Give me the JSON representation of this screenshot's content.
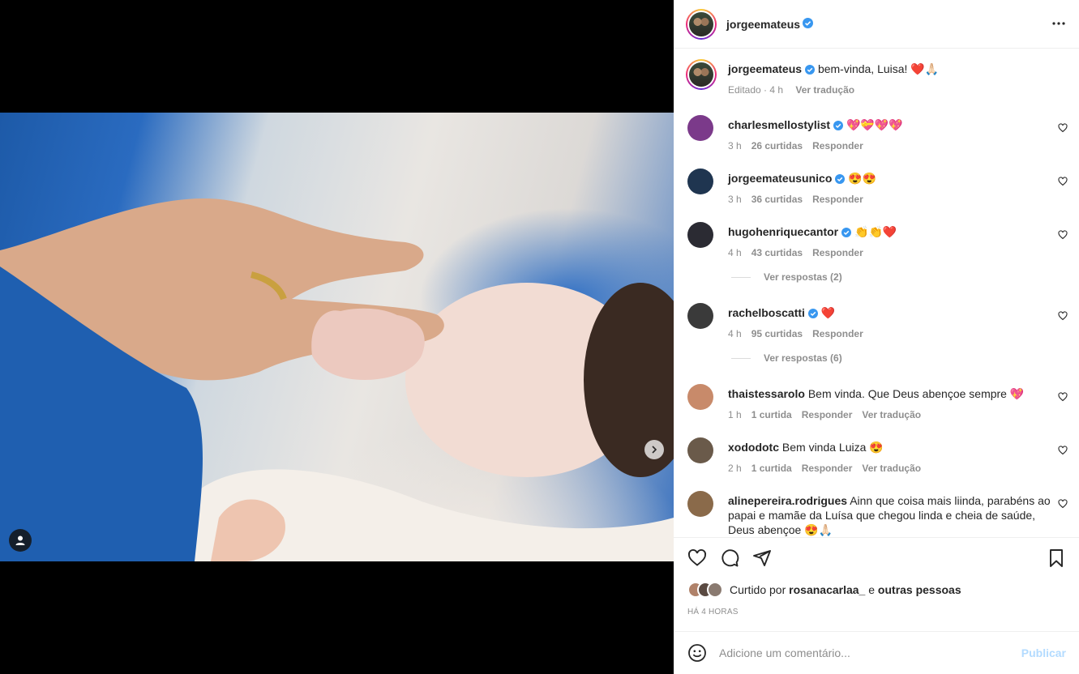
{
  "post": {
    "author": "jorgeemateus",
    "media_dots": 3,
    "active_dot": 1
  },
  "caption": {
    "username": "jorgeemateus",
    "text": "bem-vinda, Luisa! ❤️🙏🏻",
    "meta_edited": "Editado · 4 h",
    "translate": "Ver tradução"
  },
  "comments": [
    {
      "username": "charlesmellostylist",
      "verified": true,
      "text": "💖💝💖💖",
      "time": "3 h",
      "likes": "26 curtidas",
      "reply": "Responder",
      "translate": "",
      "avatar_color": "#7b3a8a"
    },
    {
      "username": "jorgeemateusunico",
      "verified": true,
      "text": "😍😍",
      "time": "3 h",
      "likes": "36 curtidas",
      "reply": "Responder",
      "translate": "",
      "avatar_color": "#1f3550"
    },
    {
      "username": "hugohenriquecantor",
      "verified": true,
      "text": "👏👏❤️",
      "time": "4 h",
      "likes": "43 curtidas",
      "reply": "Responder",
      "translate": "",
      "avatar_color": "#2b2b33",
      "replies": "Ver respostas (2)"
    },
    {
      "username": "rachelboscatti",
      "verified": true,
      "text": "❤️",
      "time": "4 h",
      "likes": "95 curtidas",
      "reply": "Responder",
      "translate": "",
      "avatar_color": "#3a3a3a",
      "replies": "Ver respostas (6)"
    },
    {
      "username": "thaistessarolo",
      "verified": false,
      "text": "Bem vinda. Que Deus abençoe sempre 💖",
      "time": "1 h",
      "likes": "1 curtida",
      "reply": "Responder",
      "translate": "Ver tradução",
      "avatar_color": "#c88a6a"
    },
    {
      "username": "xododotc",
      "verified": false,
      "text": "Bem vinda Luiza 😍",
      "time": "2 h",
      "likes": "1 curtida",
      "reply": "Responder",
      "translate": "Ver tradução",
      "avatar_color": "#6a5a4a"
    },
    {
      "username": "alinepereira.rodrigues",
      "verified": false,
      "text": "Ainn que coisa mais liinda, parabéns ao papai e mamãe da Luísa que chegou linda e cheia de saúde, Deus abençoe 😍🙏🏻",
      "time": "",
      "likes": "",
      "reply": "",
      "translate": "",
      "avatar_color": "#8a6a4a"
    }
  ],
  "likes": {
    "prefix": "Curtido por ",
    "user": "rosanacarlaa_",
    "suffix_connector": " e ",
    "suffix": "outras pessoas"
  },
  "timestamp": "HÁ 4 HORAS",
  "add_comment": {
    "placeholder": "Adicione um comentário...",
    "publish": "Publicar"
  },
  "colors": {
    "verified": "#3897f0",
    "muted": "#8e8e8e",
    "publish_disabled": "#b3dbff"
  }
}
